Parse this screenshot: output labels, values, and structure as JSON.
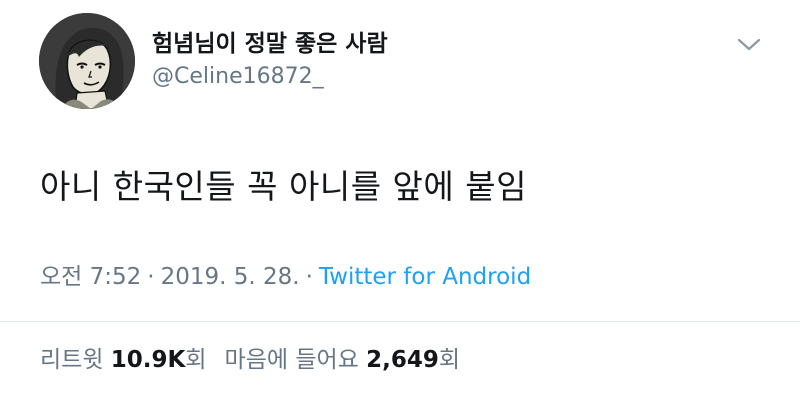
{
  "user": {
    "display_name": "험념님이 정말 좋은 사람",
    "handle": "@Celine16872_",
    "avatar_icon": "cartoon-woman-avatar"
  },
  "menu": {
    "icon": "chevron-down-icon"
  },
  "tweet": {
    "text": "아니 한국인들 꼭 아니를 앞에 붙임",
    "time": "오전 7:52",
    "separator": "·",
    "date": "2019. 5. 28.",
    "source": "Twitter for Android"
  },
  "stats": {
    "retweets_label": "리트윗",
    "retweets_count": "10.9K",
    "retweets_unit": "회",
    "likes_label": "마음에 들어요",
    "likes_count": "2,649",
    "likes_unit": "회"
  },
  "colors": {
    "text": "#14171a",
    "muted": "#657786",
    "link": "#1da1f2",
    "divider": "#e1e8ed"
  }
}
